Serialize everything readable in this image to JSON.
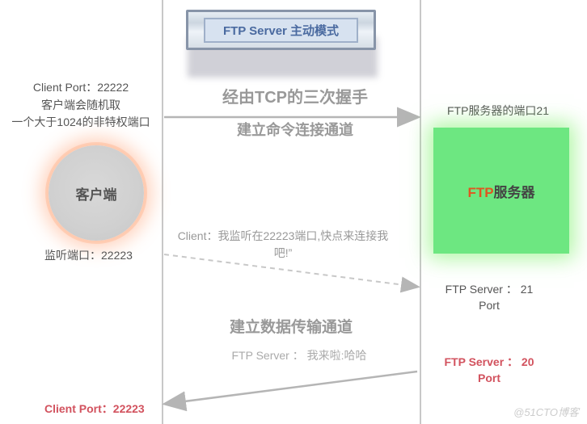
{
  "title": "FTP Server 主动模式",
  "client": {
    "port_line": "Client Port：22222",
    "desc1": "客户端会随机取",
    "desc2": "一个大于1024的非特权端口",
    "label": "客户端",
    "listen_port": "监听端口：22223",
    "bottom_port": "Client Port：22223"
  },
  "server": {
    "port_line": "FTP服务器的端口21",
    "ftp": "FTP",
    "label": "服务器",
    "port21_l1": "FTP Server ： 21",
    "port21_l2": "Port",
    "port20_l1": "FTP Server ： 20",
    "port20_l2": "Port"
  },
  "flows": {
    "handshake1": "经由TCP的三次握手",
    "handshake2": "建立命令连接通道",
    "client_msg": "Client：我监听在22223端口,快点来连接我吧!”",
    "data_channel": "建立数据传输通道",
    "server_msg": "FTP Server ： 我来啦:哈哈"
  },
  "watermark": "@51CTO博客"
}
